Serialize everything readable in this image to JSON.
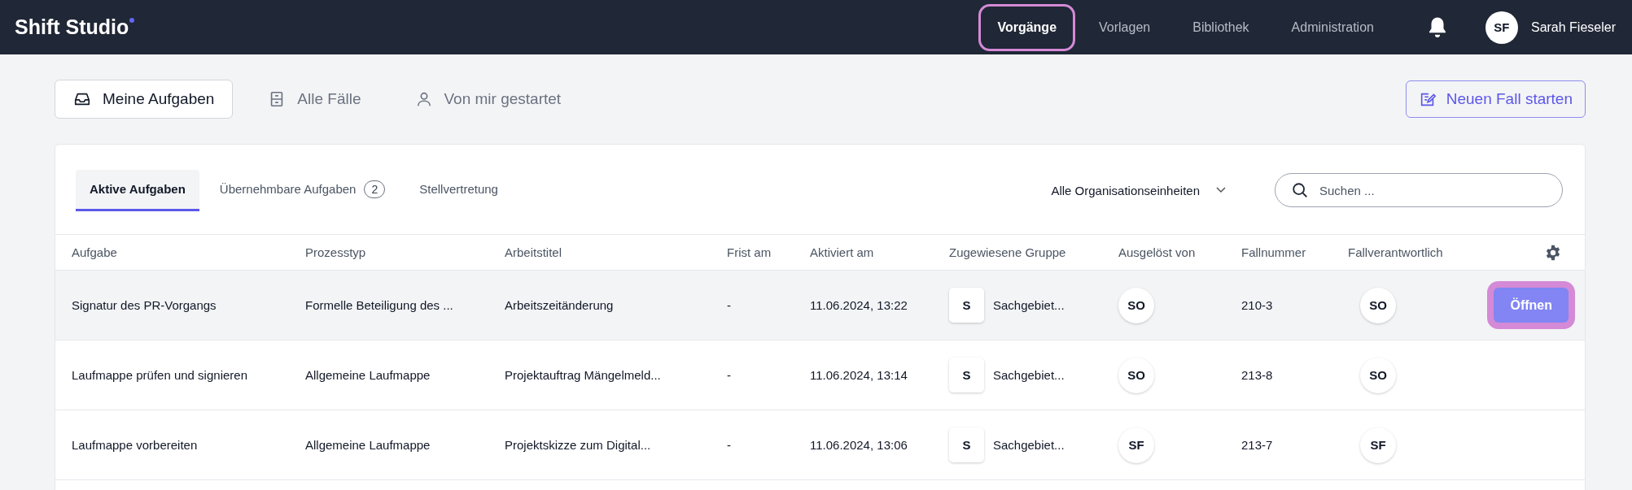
{
  "app": {
    "title": "Shift Studio"
  },
  "nav": [
    {
      "label": "Vorgänge",
      "selected": true
    },
    {
      "label": "Vorlagen",
      "selected": false
    },
    {
      "label": "Bibliothek",
      "selected": false
    },
    {
      "label": "Administration",
      "selected": false
    }
  ],
  "user": {
    "initials": "SF",
    "name": "Sarah Fieseler"
  },
  "views": [
    {
      "label": "Meine Aufgaben",
      "kind": "inbox",
      "selected": true
    },
    {
      "label": "Alle Fälle",
      "kind": "cabinet",
      "selected": false
    },
    {
      "label": "Von mir gestartet",
      "kind": "person",
      "selected": false
    }
  ],
  "new_case_button": "Neuen Fall starten",
  "task_tabs": [
    {
      "label": "Aktive Aufgaben",
      "selected": true
    },
    {
      "label": "Übernehmbare Aufgaben",
      "count": "2",
      "selected": false
    },
    {
      "label": "Stellvertretung",
      "selected": false
    }
  ],
  "org_filter": "Alle Organisationseinheiten",
  "search": {
    "placeholder": "Suchen ..."
  },
  "table": {
    "columns": [
      "Aufgabe",
      "Prozesstyp",
      "Arbeitstitel",
      "Frist am",
      "Aktiviert am",
      "Zugewiesene Gruppe",
      "Ausgelöst von",
      "Fallnummer",
      "Fallverantwortlich"
    ],
    "rows": [
      {
        "task": "Signatur des PR-Vorgangs",
        "process": "Formelle Beteiligung des ...",
        "title": "Arbeitszeitänderung",
        "deadline": "-",
        "activated": "11.06.2024, 13:22",
        "group_badge": "S",
        "group": "Sachgebiet...",
        "triggered_by": "SO",
        "case_number": "210-3",
        "owner": "SO",
        "hovered": true,
        "action": "Öffnen"
      },
      {
        "task": "Laufmappe prüfen und signieren",
        "process": "Allgemeine Laufmappe",
        "title": "Projektauftrag Mängelmeld...",
        "deadline": "-",
        "activated": "11.06.2024, 13:14",
        "group_badge": "S",
        "group": "Sachgebiet...",
        "triggered_by": "SO",
        "case_number": "213-8",
        "owner": "SO",
        "hovered": false
      },
      {
        "task": "Laufmappe vorbereiten",
        "process": "Allgemeine Laufmappe",
        "title": "Projektskizze zum Digital...",
        "deadline": "-",
        "activated": "11.06.2024, 13:06",
        "group_badge": "S",
        "group": "Sachgebiet...",
        "triggered_by": "SF",
        "case_number": "213-7",
        "owner": "SF",
        "hovered": false
      }
    ]
  }
}
